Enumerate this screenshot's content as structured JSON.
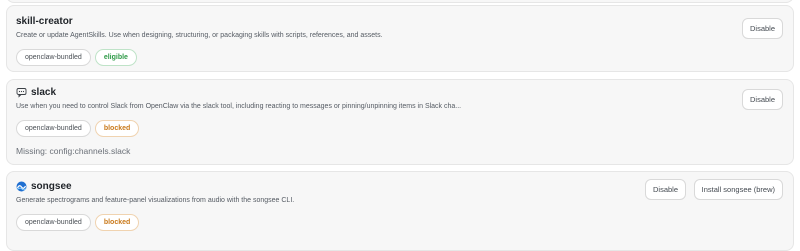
{
  "skills": [
    {
      "name": "skill-creator",
      "icon": "",
      "description": "Create or update AgentSkills. Use when designing, structuring, or packaging skills with scripts, references, and assets.",
      "tags": [
        {
          "label": "openclaw-bundled",
          "kind": "source"
        },
        {
          "label": "eligible",
          "kind": "eligible"
        }
      ],
      "buttons": [
        "Disable"
      ],
      "missing": ""
    },
    {
      "name": "slack",
      "icon": "speech-bubble-icon",
      "description": "Use when you need to control Slack from OpenClaw via the slack tool, including reacting to messages or pinning/unpinning items in Slack cha...",
      "tags": [
        {
          "label": "openclaw-bundled",
          "kind": "source"
        },
        {
          "label": "blocked",
          "kind": "blocked"
        }
      ],
      "buttons": [
        "Disable"
      ],
      "missing": "Missing: config:channels.slack"
    },
    {
      "name": "songsee",
      "icon": "wave-icon",
      "description": "Generate spectrograms and feature-panel visualizations from audio with the songsee CLI.",
      "tags": [
        {
          "label": "openclaw-bundled",
          "kind": "source"
        },
        {
          "label": "blocked",
          "kind": "blocked"
        }
      ],
      "buttons": [
        "Disable",
        "Install songsee (brew)"
      ],
      "missing": ""
    }
  ],
  "colors": {
    "card_bg": "#f7f7f7",
    "border": "#e6e6e6",
    "eligible": "#2e9a47",
    "blocked": "#c9791a"
  }
}
